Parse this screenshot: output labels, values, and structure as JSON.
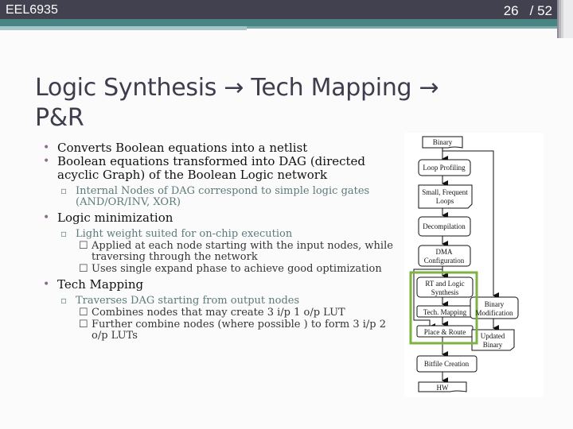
{
  "header": {
    "course": "EEL6935",
    "page_current": "26",
    "page_total": "/ 52"
  },
  "slide": {
    "title_line1": "Logic Synthesis → Tech Mapping →",
    "title_line2": "P&R",
    "bullets": [
      {
        "text": "Converts Boolean equations into a netlist"
      },
      {
        "text": "Boolean equations transformed into DAG (directed acyclic Graph) of the Boolean Logic network",
        "sub": [
          {
            "text": "Internal Nodes of DAG correspond to simple logic gates (AND/OR/INV, XOR)"
          }
        ]
      },
      {
        "text": "Logic minimization",
        "sub": [
          {
            "text": "Light weight suited for on-chip execution",
            "sub": [
              {
                "text": "Applied at each node starting with the input nodes, while traversing through the network"
              },
              {
                "text": "Uses single expand phase to achieve good optimization"
              }
            ]
          }
        ]
      },
      {
        "text": "Tech Mapping",
        "sub": [
          {
            "text": "Traverses DAG starting from output nodes",
            "sub": [
              {
                "text": "Combines nodes that may create 3 i/p 1 o/p LUT"
              },
              {
                "text": "Further combine nodes (where possible ) to form 3 i/p 2 o/p LUTs"
              }
            ]
          }
        ]
      }
    ]
  },
  "diagram": {
    "highlight_color": "#7cb342",
    "nodes": {
      "binary": "Binary",
      "loop_profiling": "Loop Profiling",
      "small_loops_1": "Small, Frequent",
      "small_loops_2": "Loops",
      "decompilation": "Decompilation",
      "dma_1": "DMA",
      "dma_2": "Configuration",
      "rt_1": "RT and Logic",
      "rt_2": "Synthesis",
      "tech_mapping": "Tech. Mapping",
      "place_route": "Place & Route",
      "bitfile": "Bitfile Creation",
      "hw": "HW",
      "binmod_1": "Binary",
      "binmod_2": "Modification",
      "updated_1": "Updated",
      "updated_2": "Binary"
    }
  }
}
